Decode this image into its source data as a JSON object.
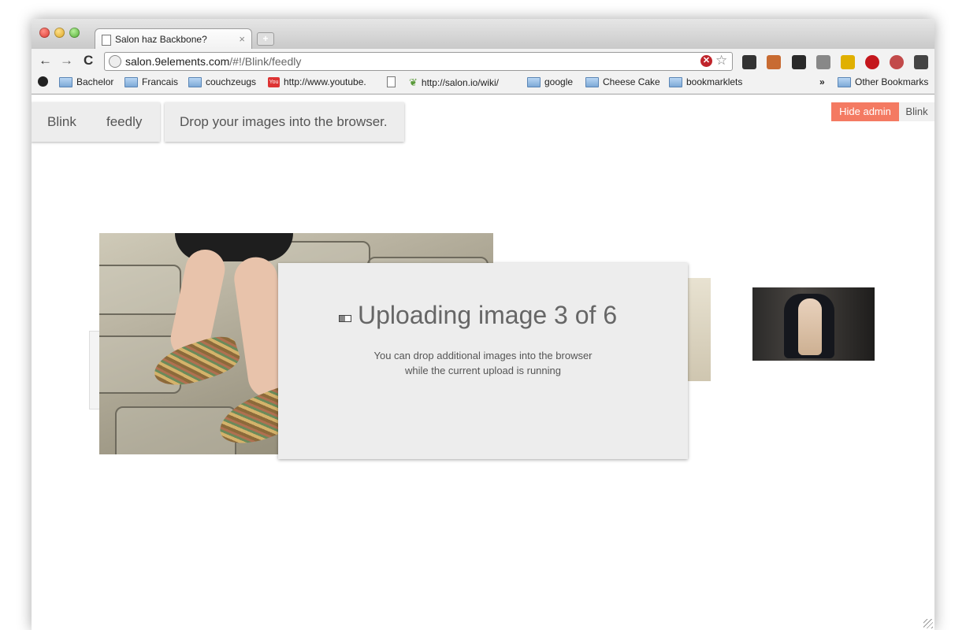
{
  "browser": {
    "tab_title": "Salon haz Backbone?",
    "tab_close": "×",
    "new_tab": "+",
    "back": "←",
    "forward": "→",
    "reload": "C",
    "url_host": "salon.9elements.com",
    "url_path": "/#!/Blink/feedly",
    "stop": "✕",
    "star": "☆",
    "extensions": [
      {
        "icon": "wrench-key-icon"
      },
      {
        "icon": "cake-icon"
      },
      {
        "icon": "glasses-icon"
      },
      {
        "icon": "tag-icon"
      },
      {
        "icon": "phone-arrow-icon"
      },
      {
        "icon": "stop-hand-icon"
      },
      {
        "icon": "tomato-icon"
      },
      {
        "icon": "wrench-icon"
      }
    ]
  },
  "bookmarks": {
    "items": [
      {
        "label": "Bachelor",
        "icon": "folder-icon"
      },
      {
        "label": "Francais",
        "icon": "folder-icon"
      },
      {
        "label": "couchzeugs",
        "icon": "folder-icon"
      },
      {
        "label": "http://www.youtube.",
        "icon": "youtube-icon"
      },
      {
        "label": "",
        "icon": "page-icon"
      },
      {
        "label": "http://salon.io/wiki/",
        "icon": "leaf-icon"
      },
      {
        "label": "google",
        "icon": "folder-icon"
      },
      {
        "label": "Cheese Cake",
        "icon": "folder-icon"
      },
      {
        "label": "bookmarklets",
        "icon": "folder-icon"
      }
    ],
    "overflow": "»",
    "other": "Other Bookmarks"
  },
  "page": {
    "breadcrumb": {
      "first": "Blink",
      "second": "feedly"
    },
    "drop_message": "Drop your images into the browser.",
    "hide_admin": "Hide admin",
    "user": "Blink",
    "upload": {
      "headline": "Uploading image 3 of 6",
      "progress": 0.5,
      "line1": "You can drop additional images into the browser",
      "line2": "while the current upload is running"
    }
  },
  "colors": {
    "accent": "#f47a62",
    "panel": "#ededed"
  }
}
